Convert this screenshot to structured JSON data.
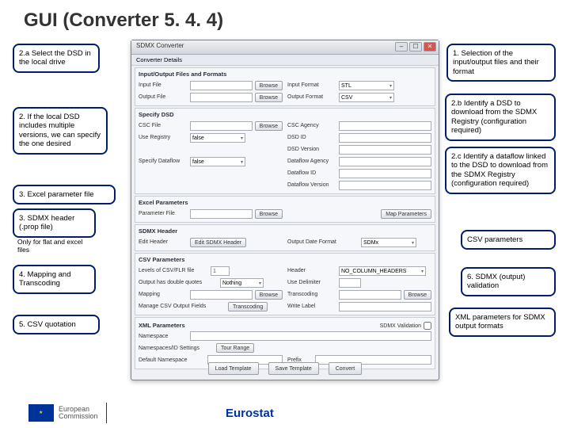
{
  "title": {
    "prefix": "GUI",
    "rest": " (Converter 5. 4. 4)"
  },
  "callouts": {
    "c2a": "2.a Select the DSD in the local drive",
    "c2if": "2. If the local DSD includes multiple versions, we can specify the one desired",
    "c3": "3. Excel parameter file",
    "c3sdmx": "3. SDMX header (.prop file)",
    "note_flat": "Only for flat and excel files",
    "c4": "4. Mapping and Transcoding",
    "c5": "5. CSV quotation",
    "c1": "1. Selection of the input/output files and their format",
    "c2b": "2.b Identify a DSD to download from the SDMX Registry (configuration required)",
    "c2c": "2.c Identify a dataflow linked to the DSD to download from the SDMX Registry (configuration required)",
    "csvp": "CSV parameters",
    "c6": "6. SDMX (output) validation",
    "cxml": "XML parameters for SDMX output formats"
  },
  "app": {
    "title": "SDMX Converter",
    "tab": "Converter Details",
    "sec1": "Input/Output Files and Formats",
    "inputFile": "Input File",
    "browse": "Browse",
    "inputFormat": "Input Format",
    "fmt1": "STL",
    "outputFile": "Output File",
    "outputFormat": "Output Format",
    "fmt2": "CSV",
    "specifyDsd": "Specify DSD",
    "cscFile": "CSC File",
    "cscAgency": "CSC Agency",
    "useRegistry": "Use Registry",
    "false": "false",
    "dsdId": "DSD ID",
    "dsdVersion": "DSD Version",
    "specifyDataflow": "Specify Dataflow",
    "dataflowAgency": "Dataflow Agency",
    "dataflowId": "Dataflow ID",
    "dataflowVersion": "Dataflow Version",
    "excelParams": "Excel Parameters",
    "parameterFile": "Parameter File",
    "mapParameters": "Map Parameters",
    "sdmxHeader": "SDMX Header",
    "editHeader": "Edit Header",
    "editSdmx": "Edit SDMX Header",
    "outputDateFormat": "Output Date Format",
    "sdmx_v": "SDMx",
    "csvParameters": "CSV Parameters",
    "levels": "Levels of CSV/FLR file",
    "one": "1",
    "header": "Header",
    "noColHeaders": "NO_COLUMN_HEADERS",
    "outputHasDouble": "Output has double quotes",
    "nothing": "Nothing",
    "useDelimiter": "Use Delimiter",
    "mapping": "Mapping",
    "transcoding": "Transcoding",
    "mapCsvOutputFields": "Manage CSV Output Fields",
    "writeLabel": "Write Label",
    "xmlParameters": "XML Parameters",
    "sdmxValidation": "SDMX Validation",
    "namespace": "Namespace",
    "tonsSettings": "Namespaces/ID Settings",
    "tourRange": "Tour Range",
    "defaultNamespace": "Default Namespace",
    "prefix": "Prefix",
    "loadTemplate": "Load Template",
    "saveTemplate": "Save Template",
    "convert": "Convert"
  },
  "footer": {
    "ec1": "European",
    "ec2": "Commission",
    "eurostat": "Eurostat"
  }
}
